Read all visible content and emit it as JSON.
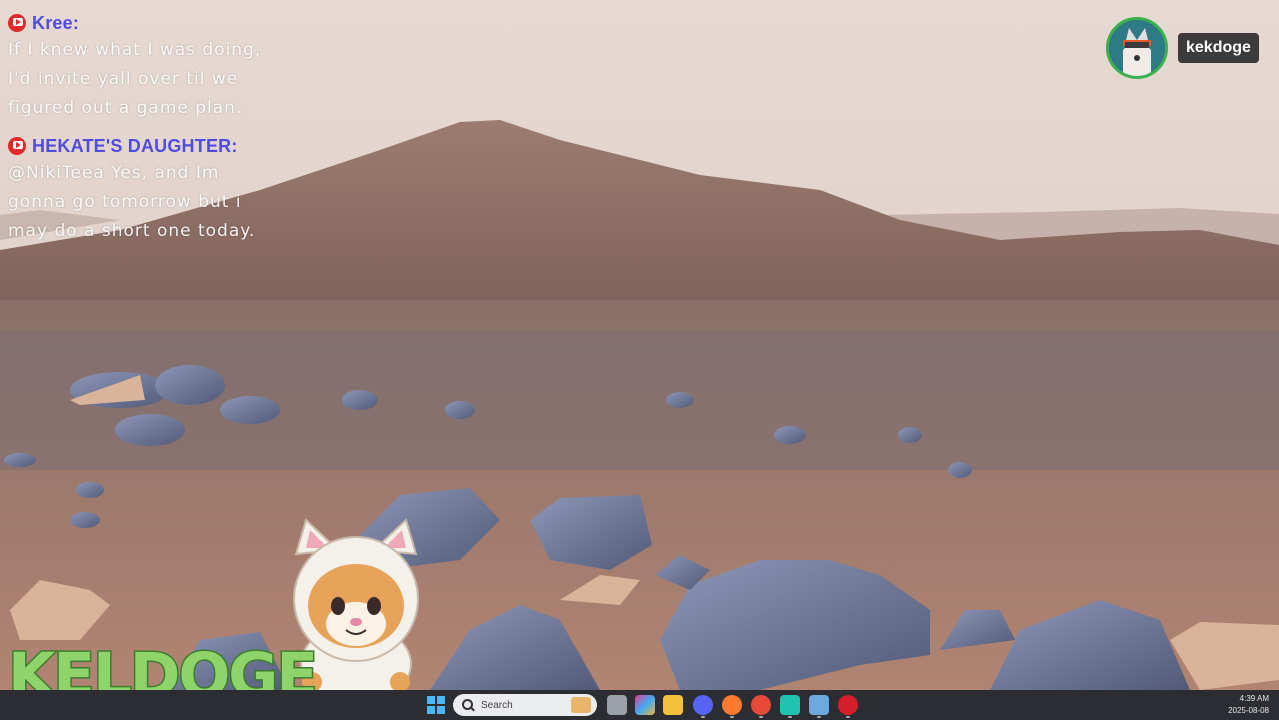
{
  "chat": {
    "messages": [
      {
        "platform_icon": "youtube-icon",
        "user": "Kree",
        "separator": ":",
        "text": "If I knew what I was doing, I'd invite yall over til we figured out a game plan."
      },
      {
        "platform_icon": "youtube-icon",
        "user": "HEKATE'S DAUGHTER",
        "separator": ":",
        "text": "@NikiTeea Yes, and Im gonna go tomorrow but i may do a short one today."
      }
    ]
  },
  "user_badge": {
    "name": "kekdoge",
    "avatar_icon": "dog-avatar-icon"
  },
  "logo": {
    "text": "KELDOGE"
  },
  "taskbar": {
    "search_placeholder": "Search",
    "apps": [
      "windows-start-icon",
      "task-view-icon",
      "copilot-icon",
      "file-explorer-icon",
      "discord-icon",
      "firefox-icon",
      "chrome-icon",
      "app-icon",
      "notepad-icon",
      "youtube-app-icon"
    ],
    "clock_time": "4:39 AM",
    "clock_date": "2025-08-08"
  },
  "colors": {
    "username": "#4f4ce0",
    "logo_fill": "#8fd46b",
    "logo_stroke": "#3b7d2d",
    "avatar_ring": "#38b24a",
    "taskbar_bg": "#2b2d33"
  }
}
